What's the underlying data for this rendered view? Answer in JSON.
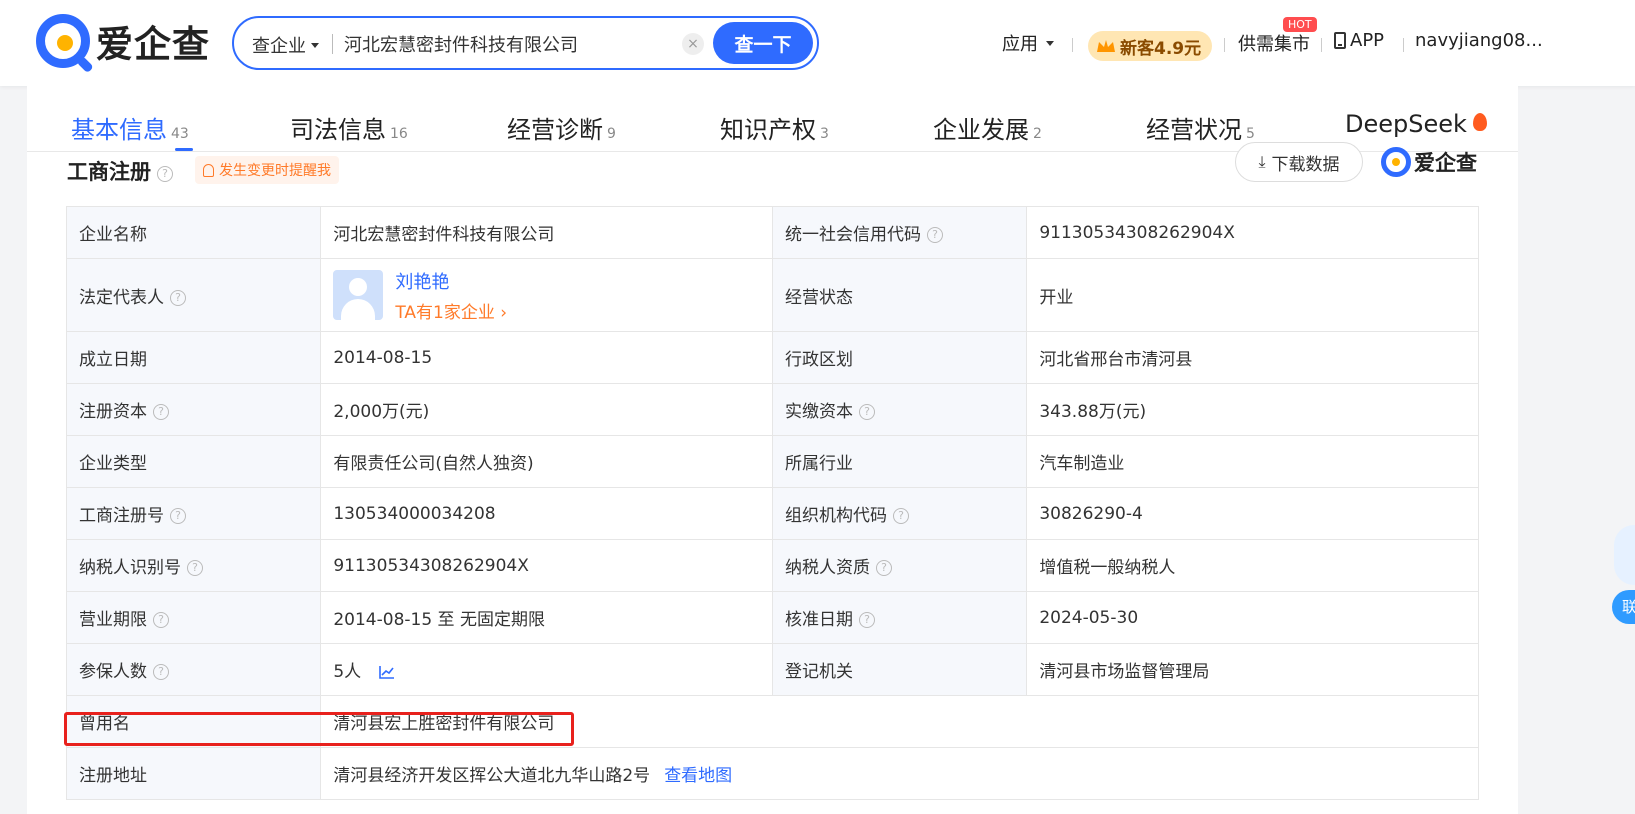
{
  "header": {
    "logo_text": "爱企查",
    "search": {
      "type_label": "查企业",
      "query": "河北宏慧密封件科技有限公司",
      "clear_glyph": "×",
      "button_label": "查一下"
    },
    "nav": {
      "apps_label": "应用",
      "promo_label": "新客4.9元",
      "market_label": "供需集市",
      "hot_badge": "HOT",
      "app_label": "APP",
      "user_label": "navyjiang08..."
    }
  },
  "tabs": [
    {
      "label": "基本信息",
      "count": "43",
      "active": true
    },
    {
      "label": "司法信息",
      "count": "16"
    },
    {
      "label": "经营诊断",
      "count": "9"
    },
    {
      "label": "知识产权",
      "count": "3"
    },
    {
      "label": "企业发展",
      "count": "2"
    },
    {
      "label": "经营状况",
      "count": "5"
    },
    {
      "label": "DeepSeek",
      "count": ""
    }
  ],
  "section": {
    "title": "工商注册",
    "remind_label": "发生变更时提醒我",
    "download_label": "下载数据",
    "brand_label": "爱企查"
  },
  "registration": {
    "company_name_label": "企业名称",
    "company_name": "河北宏慧密封件科技有限公司",
    "credit_code_label": "统一社会信用代码",
    "credit_code": "91130534308262904X",
    "legal_rep_label": "法定代表人",
    "legal_rep_name": "刘艳艳",
    "legal_rep_sub": "TA有1家企业 ›",
    "status_label": "经营状态",
    "status": "开业",
    "founded_label": "成立日期",
    "founded": "2014-08-15",
    "region_label": "行政区划",
    "region": "河北省邢台市清河县",
    "reg_capital_label": "注册资本",
    "reg_capital": "2,000万(元)",
    "paid_capital_label": "实缴资本",
    "paid_capital": "343.88万(元)",
    "type_label": "企业类型",
    "type": "有限责任公司(自然人独资)",
    "industry_label": "所属行业",
    "industry": "汽车制造业",
    "reg_no_label": "工商注册号",
    "reg_no": "130534000034208",
    "org_code_label": "组织机构代码",
    "org_code": "30826290-4",
    "tax_id_label": "纳税人识别号",
    "tax_id": "91130534308262904X",
    "tax_qual_label": "纳税人资质",
    "tax_qual": "增值税一般纳税人",
    "term_label": "营业期限",
    "term": "2014-08-15 至 无固定期限",
    "approved_label": "核准日期",
    "approved": "2024-05-30",
    "insured_label": "参保人数",
    "insured": "5人",
    "authority_label": "登记机关",
    "authority": "清河县市场监督管理局",
    "former_name_label": "曾用名",
    "former_name": "清河县宏上胜密封件有限公司",
    "address_label": "注册地址",
    "address": "清河县经济开发区挥公大道北九华山路2号",
    "map_link": "查看地图"
  },
  "side": {
    "button_label": "联"
  },
  "colors": {
    "brand_blue": "#2f6bff",
    "accent_orange": "#ff7a29",
    "highlight_red": "#e8211d"
  }
}
